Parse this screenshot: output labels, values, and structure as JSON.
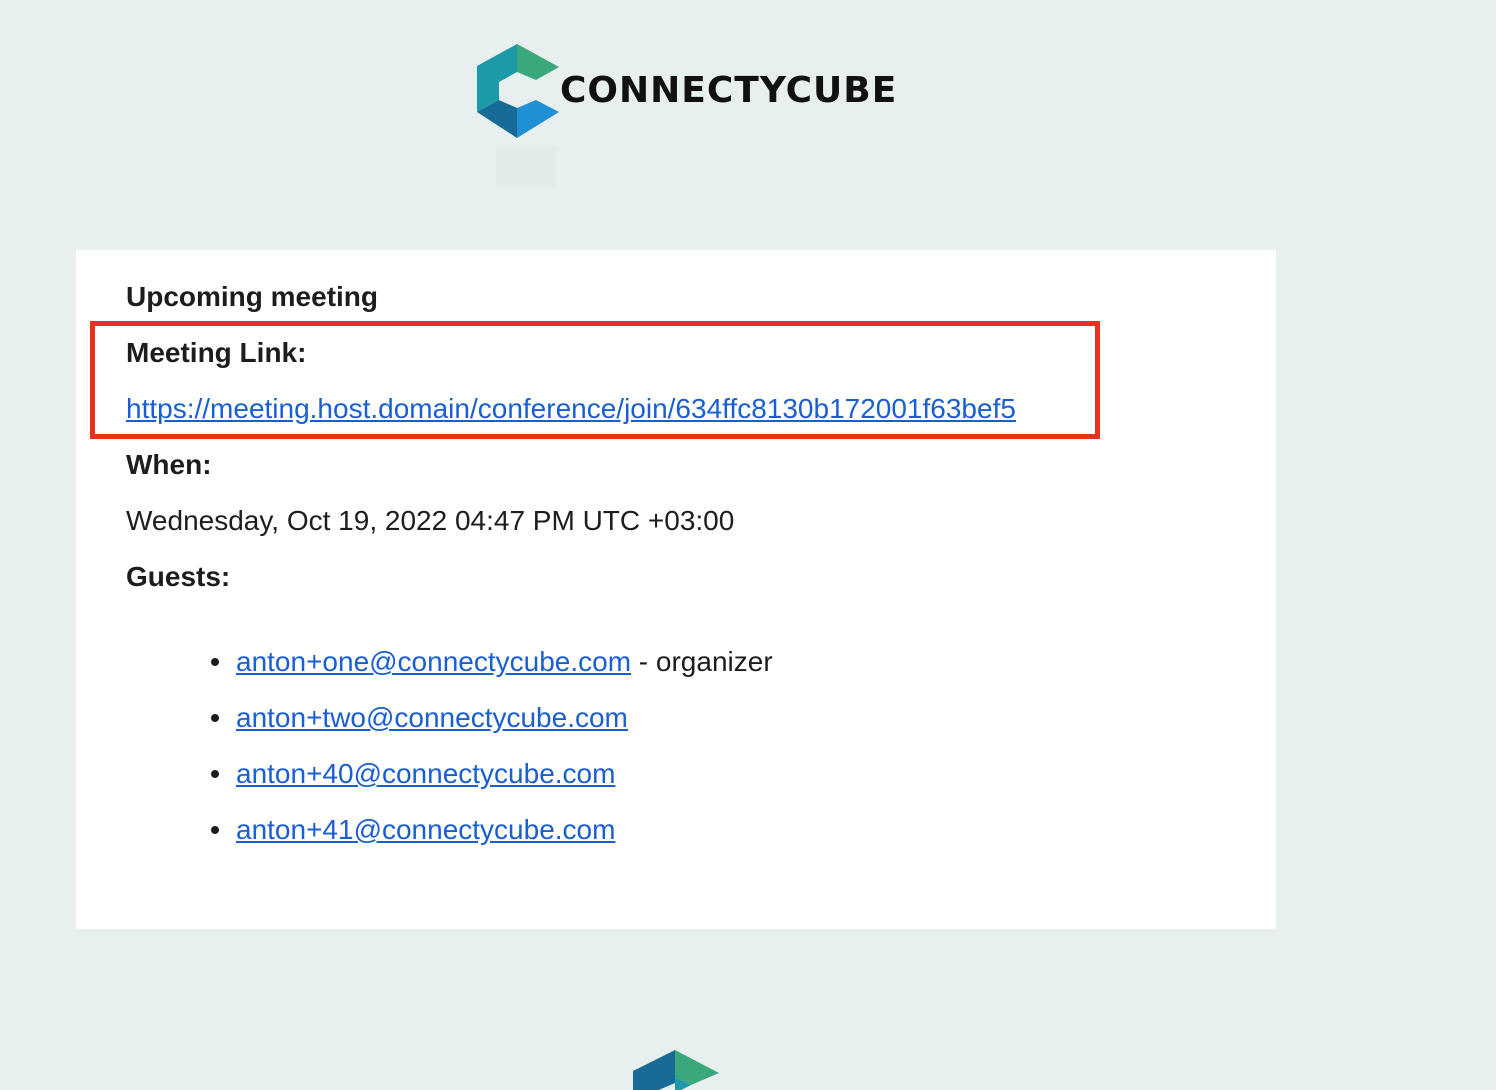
{
  "brand": {
    "name": "CONNECTYCUBE",
    "icon": "connectycube-logo-icon",
    "colors": {
      "teal": "#1c9aa8",
      "green": "#3aa87a",
      "blue": "#1f8fd6",
      "dark_blue": "#176b96"
    }
  },
  "email": {
    "title": "Upcoming meeting",
    "meeting_link_label": "Meeting Link:",
    "meeting_link_url": "https://meeting.host.domain/conference/join/634ffc8130b172001f63bef5",
    "when_label": "When:",
    "when_value": "Wednesday, Oct 19, 2022 04:47 PM UTC +03:00",
    "guests_label": "Guests:",
    "guests": [
      {
        "email": "anton+one@connectycube.com",
        "suffix": " - organizer"
      },
      {
        "email": "anton+two@connectycube.com",
        "suffix": ""
      },
      {
        "email": "anton+40@connectycube.com",
        "suffix": ""
      },
      {
        "email": "anton+41@connectycube.com",
        "suffix": ""
      }
    ]
  },
  "annotation": {
    "highlight_color": "#e8321f"
  },
  "page": {
    "background": "#e8f0ef",
    "card_background": "#ffffff",
    "link_color": "#1a5fd1"
  }
}
